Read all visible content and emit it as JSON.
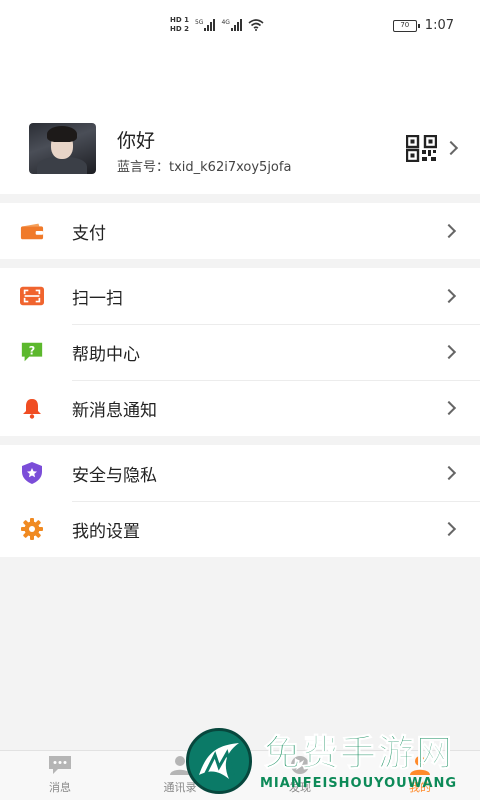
{
  "status_bar": {
    "hd1": "HD 1",
    "hd2": "HD 2",
    "net1": "5G",
    "net2": "4G",
    "battery": "70",
    "time": "1:07"
  },
  "profile": {
    "name": "你好",
    "id_text": "蓝言号：txid_k62i7xoy5jofa"
  },
  "groups": [
    {
      "items": [
        {
          "label": "支付",
          "icon": "wallet-icon",
          "color": "#f07a2a"
        }
      ]
    },
    {
      "items": [
        {
          "label": "扫一扫",
          "icon": "scan-icon",
          "color": "#f0642e"
        },
        {
          "label": "帮助中心",
          "icon": "help-icon",
          "color": "#5cb82d"
        },
        {
          "label": "新消息通知",
          "icon": "bell-icon",
          "color": "#f04d23"
        }
      ]
    },
    {
      "items": [
        {
          "label": "安全与隐私",
          "icon": "shield-icon",
          "color": "#7b4dd8"
        },
        {
          "label": "我的设置",
          "icon": "gear-icon",
          "color": "#f08a22"
        }
      ]
    }
  ],
  "bottom_nav": [
    {
      "label": "消息",
      "icon": "chat-icon",
      "active": false
    },
    {
      "label": "通讯录",
      "icon": "contacts-icon",
      "active": false
    },
    {
      "label": "发现",
      "icon": "discover-icon",
      "active": false
    },
    {
      "label": "我的",
      "icon": "profile-icon",
      "active": true
    }
  ],
  "watermark": {
    "title": "免费手游网",
    "subtitle": "MIANFEISHOUYOUWANG"
  }
}
